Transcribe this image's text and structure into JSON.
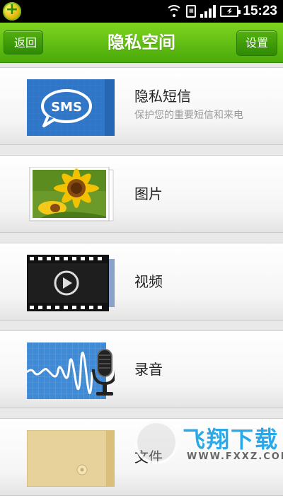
{
  "status_bar": {
    "time": "15:23",
    "icons": [
      "app-badge-icon",
      "wifi-icon",
      "sim-icon",
      "signal-icon",
      "battery-charging-icon"
    ]
  },
  "title_bar": {
    "back_label": "返回",
    "title": "隐私空间",
    "settings_label": "设置",
    "accent_color": "#5cb814"
  },
  "items": [
    {
      "label": "隐私短信",
      "subtitle": "保护您的重要短信和来电",
      "icon": "sms-icon"
    },
    {
      "label": "图片",
      "icon": "sunflower-photo-icon"
    },
    {
      "label": "视频",
      "icon": "video-film-icon"
    },
    {
      "label": "录音",
      "icon": "microphone-waveform-icon"
    },
    {
      "label": "文件",
      "icon": "folder-file-icon"
    }
  ],
  "watermark": {
    "text": "飞翔下载",
    "url": "WWW.FXXZ.COM"
  }
}
